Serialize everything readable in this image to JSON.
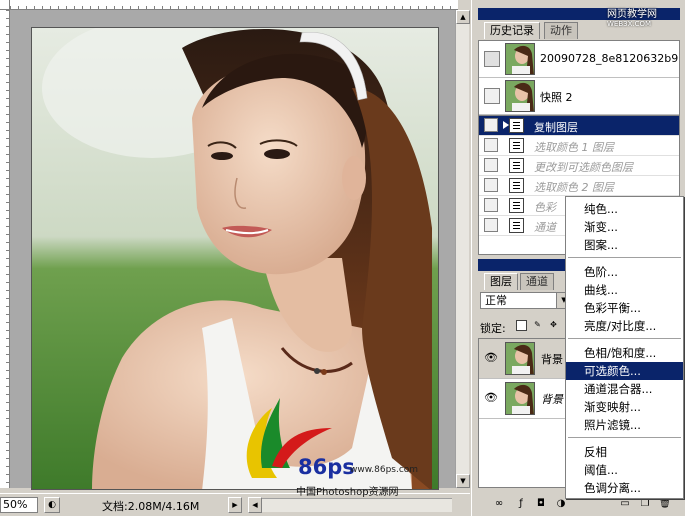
{
  "status_bar": {
    "zoom": "50%",
    "document_size": "文档:2.08M/4.16M"
  },
  "history_panel": {
    "tabs": [
      "历史记录",
      "动作"
    ],
    "snapshots": [
      {
        "label": "20090728_8e8120632b9..."
      },
      {
        "label": "快照 2"
      }
    ],
    "steps": [
      {
        "label": "复制图层",
        "state": "selected"
      },
      {
        "label": "选取颜色 1 图层",
        "state": "grayed"
      },
      {
        "label": "更改到可选颜色图层",
        "state": "grayed"
      },
      {
        "label": "选取颜色 2 图层",
        "state": "grayed"
      },
      {
        "label": "色彩",
        "state": "grayed"
      },
      {
        "label": "通道",
        "state": "grayed"
      }
    ]
  },
  "layers_panel": {
    "tabs": [
      "图层",
      "通道"
    ],
    "blend_mode": "正常",
    "lock_label": "锁定:",
    "layers": [
      {
        "name": "背景",
        "visible": true
      },
      {
        "name": "背景",
        "visible": true
      }
    ]
  },
  "context_menu": {
    "groups": [
      [
        "纯色...",
        "渐变...",
        "图案..."
      ],
      [
        "色阶...",
        "曲线...",
        "色彩平衡...",
        "亮度/对比度..."
      ],
      [
        "色相/饱和度...",
        "可选颜色...",
        "通道混合器...",
        "渐变映射...",
        "照片滤镜..."
      ],
      [
        "反相",
        "阈值...",
        "色调分离..."
      ]
    ],
    "highlighted": "可选颜色..."
  },
  "watermarks": {
    "site_top": "网页教学网",
    "site_top_sub": "WEB3X.COM",
    "logo_text": "86ps",
    "url": "www.86ps.com",
    "brand": "中国Photoshop资源网"
  },
  "colors": {
    "selection_blue": "#0a246a",
    "chrome_gray": "#d4d0c8"
  }
}
